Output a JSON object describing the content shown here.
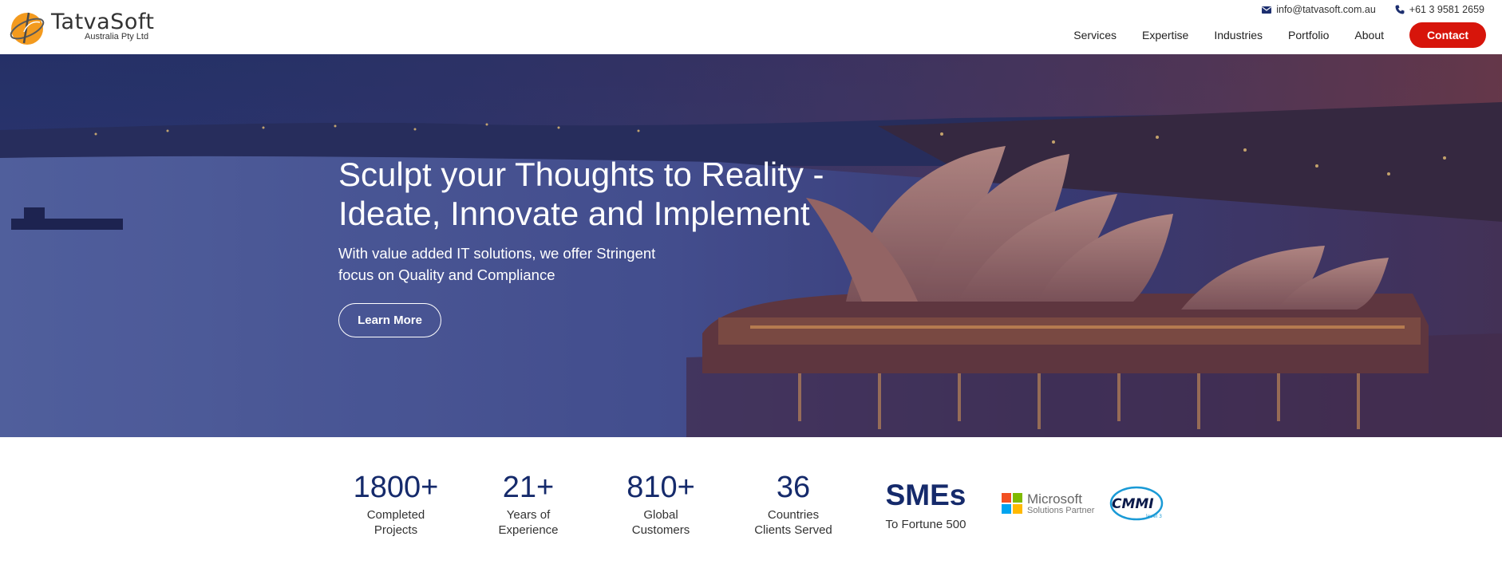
{
  "brand": {
    "name": "TatvaSoft",
    "subtitle": "Australia Pty Ltd"
  },
  "topbar": {
    "email": "info@tatvasoft.com.au",
    "phone": "+61 3 9581 2659"
  },
  "nav": {
    "items": [
      "Services",
      "Expertise",
      "Industries",
      "Portfolio",
      "About"
    ],
    "contact": "Contact"
  },
  "hero": {
    "title_line1": "Sculpt your Thoughts to Reality -",
    "title_line2": "Ideate, Innovate and Implement",
    "sub_line1": "With value added IT solutions, we offer Stringent",
    "sub_line2": "focus on Quality and Compliance",
    "cta": "Learn More"
  },
  "stats": [
    {
      "value": "1800+",
      "label1": "Completed",
      "label2": "Projects"
    },
    {
      "value": "21+",
      "label1": "Years of",
      "label2": "Experience"
    },
    {
      "value": "810+",
      "label1": "Global",
      "label2": "Customers"
    },
    {
      "value": "36",
      "label1": "Countries",
      "label2": "Clients Served"
    },
    {
      "value": "SMEs",
      "label1": "To Fortune 500"
    }
  ],
  "partners": {
    "microsoft_name": "Microsoft",
    "microsoft_sub": "Solutions Partner",
    "cmmi_text": "CMMI",
    "cmmi_level": "level 3"
  },
  "colors": {
    "brand_navy": "#152a6b",
    "contact_red": "#d7150b",
    "logo_orange": "#f39a1e"
  }
}
